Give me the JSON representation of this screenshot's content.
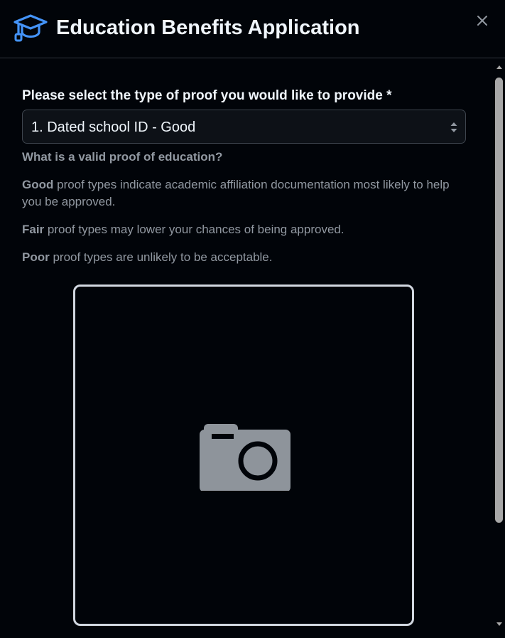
{
  "header": {
    "title": "Education Benefits Application",
    "icon": "graduation-cap-icon",
    "close_icon": "close-icon",
    "accent_color": "#4493f8"
  },
  "form": {
    "proof_label": "Please select the type of proof you would like to provide *",
    "proof_select": {
      "selected": "1. Dated school ID - Good"
    },
    "help": {
      "heading": "What is a valid proof of education?",
      "good_term": "Good",
      "good_text": " proof types indicate academic affiliation documentation most likely to help you be approved.",
      "fair_term": "Fair",
      "fair_text": " proof types may lower your chances of being approved.",
      "poor_term": "Poor",
      "poor_text": " proof types are unlikely to be acceptable."
    },
    "photo": {
      "icon": "camera-icon"
    }
  }
}
